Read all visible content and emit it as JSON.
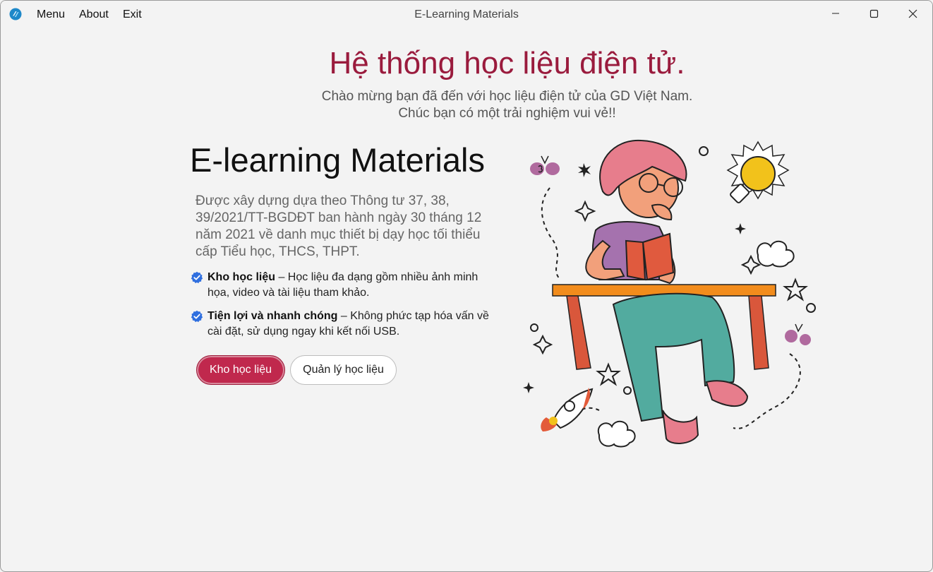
{
  "titlebar": {
    "menu_items": [
      "Menu",
      "About",
      "Exit"
    ],
    "window_title": "E-Learning Materials"
  },
  "header": {
    "title": "Hệ thống học liệu điện tử.",
    "subtitle_line1": "Chào mừng bạn đã đến với học liệu điện tử của GD Việt Nam.",
    "subtitle_line2": "Chúc bạn có một trải nghiệm vui vẻ!!"
  },
  "hero": {
    "heading": "E-learning Materials",
    "description": "Được xây dựng dựa theo Thông tư 37, 38, 39/2021/TT-BGDĐT ban hành ngày 30 tháng 12 năm 2021 về danh mục thiết bị dạy học tối thiểu cấp Tiểu học, THCS, THPT.",
    "features": [
      {
        "title": "Kho học liệu",
        "text": " – Học liệu đa dạng gồm nhiều ảnh minh họa, video và tài liệu tham khảo."
      },
      {
        "title": "Tiện lợi và nhanh chóng",
        "text": " – Không phức tạp hóa vấn về cài đặt, sử dụng ngay khi kết nối USB."
      }
    ],
    "primary_button": "Kho học liệu",
    "secondary_button": "Quản lý học liệu"
  },
  "colors": {
    "accent": "#9a1b3d",
    "primary_button": "#c0284d",
    "check_icon": "#2f6fdf"
  },
  "icons": {
    "app": "app-logo-icon",
    "minimize": "minimize-icon",
    "maximize": "maximize-icon",
    "close": "close-icon",
    "feature_check": "check-badge-icon"
  }
}
